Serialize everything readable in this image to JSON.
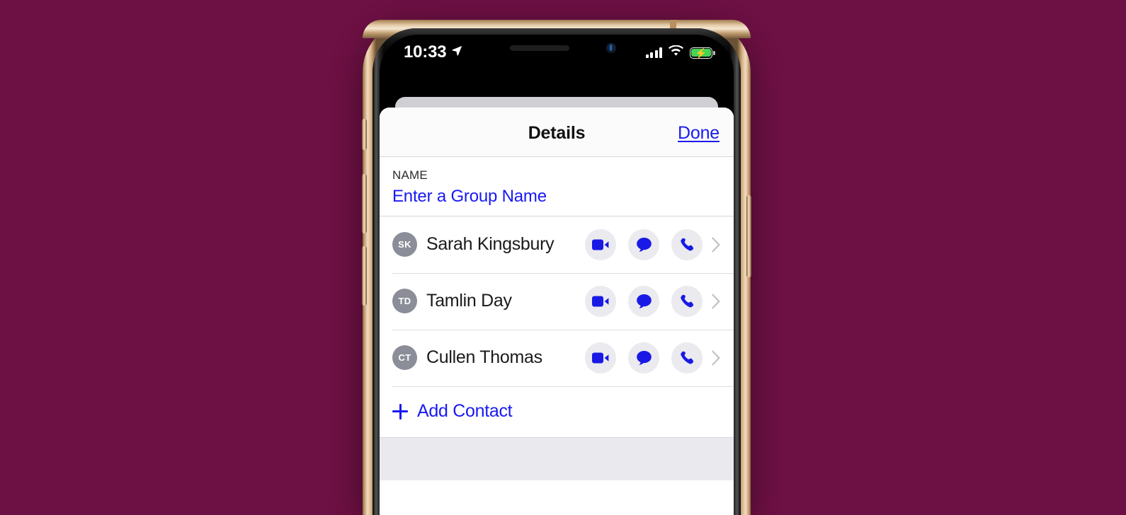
{
  "background": {
    "color": "#6d1043"
  },
  "device": {
    "frame_color": "#caa67b",
    "buttons": [
      "silent-switch",
      "volume-up",
      "volume-down",
      "power"
    ]
  },
  "status_bar": {
    "time": "10:33",
    "location_icon": "location-arrow-icon",
    "signal_icon": "cellular-signal-icon",
    "signal_bars": 4,
    "wifi_icon": "wifi-icon",
    "battery_icon": "battery-charging-icon",
    "battery_color": "#45d455",
    "battery_charging": true
  },
  "sheet": {
    "title": "Details",
    "done_label": "Done",
    "accent_color": "#1919f2",
    "name_section": {
      "label": "NAME",
      "placeholder": "Enter a Group Name",
      "value": ""
    },
    "contacts": [
      {
        "initials": "SK",
        "name": "Sarah Kingsbury",
        "actions": [
          "video-call",
          "message",
          "phone-call"
        ],
        "chevron": "chevron-right-icon"
      },
      {
        "initials": "TD",
        "name": "Tamlin Day",
        "actions": [
          "video-call",
          "message",
          "phone-call"
        ],
        "chevron": "chevron-right-icon"
      },
      {
        "initials": "CT",
        "name": "Cullen Thomas",
        "actions": [
          "video-call",
          "message",
          "phone-call"
        ],
        "chevron": "chevron-right-icon"
      }
    ],
    "add_contact": {
      "label": "Add Contact",
      "icon": "plus-icon"
    }
  }
}
